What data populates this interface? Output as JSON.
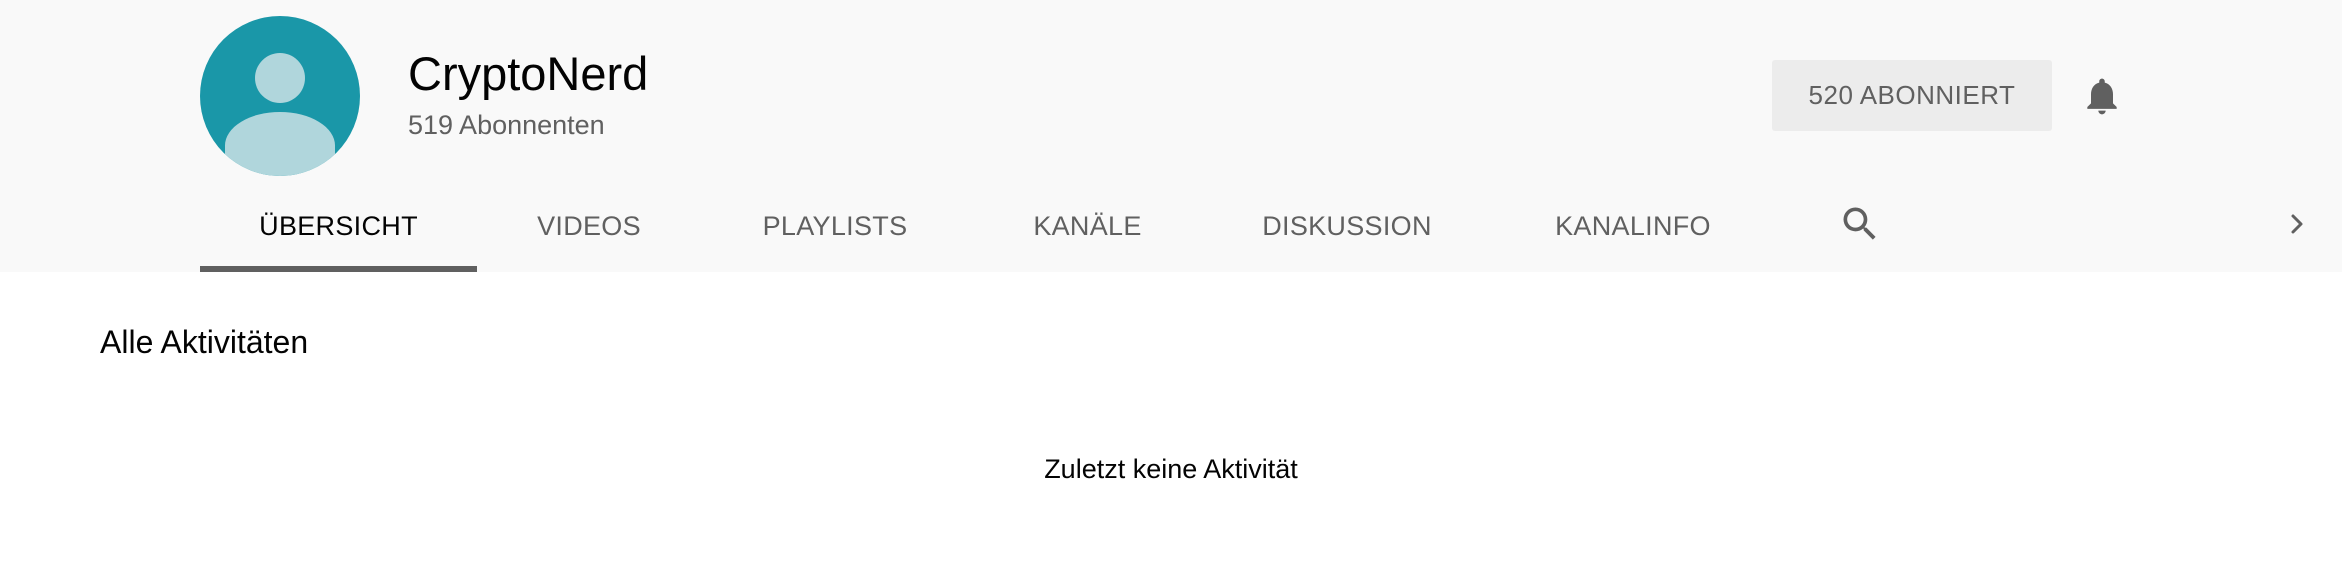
{
  "channel": {
    "name": "CryptoNerd",
    "subscribers": "519 Abonnenten",
    "subscribe_button": "520 ABONNIERT"
  },
  "tabs": [
    {
      "label": "ÜBERSICHT",
      "active": true
    },
    {
      "label": "VIDEOS"
    },
    {
      "label": "PLAYLISTS"
    },
    {
      "label": "KANÄLE"
    },
    {
      "label": "DISKUSSION"
    },
    {
      "label": "KANALINFO"
    }
  ],
  "icons": {
    "bell": "bell-icon",
    "search": "search-icon",
    "chevron": "chevron-right-icon"
  },
  "content": {
    "section_title": "Alle Aktivitäten",
    "empty_message": "Zuletzt keine Aktivität"
  },
  "colors": {
    "header_bg": "#f9f9f9",
    "avatar_bg": "#1a97a8",
    "avatar_fg": "#b0d6dc",
    "button_bg": "#ececec",
    "text_secondary": "#606060",
    "text_primary": "#030303"
  }
}
